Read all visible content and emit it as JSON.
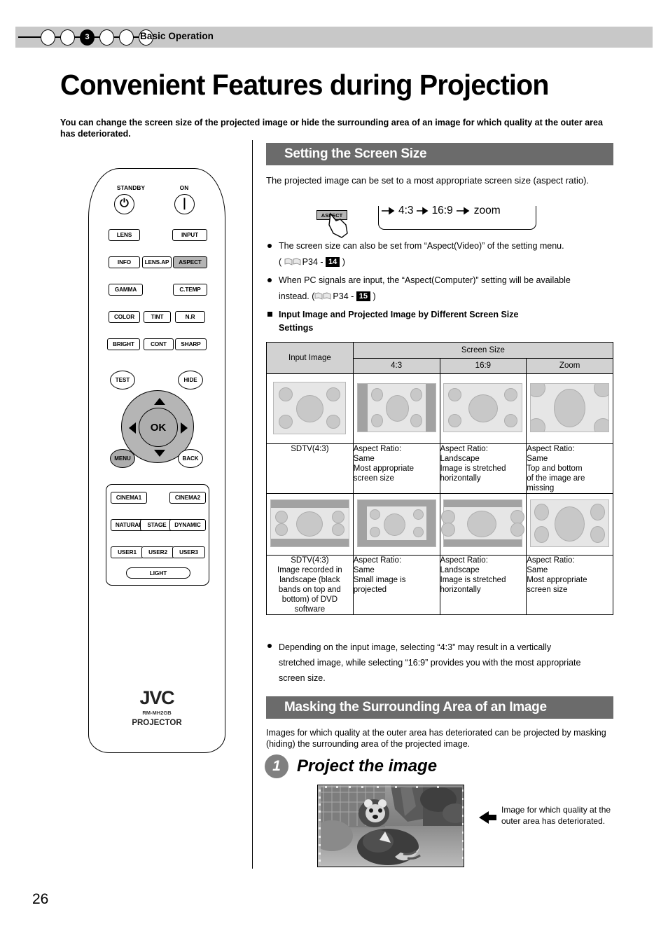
{
  "header": {
    "chapter_label": "Basic Operation",
    "chapter_number": "3",
    "dot_count": 6,
    "active_dot_index": 2
  },
  "page_title": "Convenient Features during Projection",
  "lead_text": "You can change the screen size of the projected image or hide the surrounding area of an image for which quality at the outer area has deteriorated.",
  "page_number": "26",
  "remote": {
    "standby_label": "STANDBY",
    "on_label": "ON",
    "standby_glyph": "⏻",
    "on_glyph": "❘",
    "buttons": {
      "lens": "LENS",
      "input": "INPUT",
      "info": "INFO",
      "lens_ap": "LENS.AP",
      "aspect": "ASPECT",
      "gamma": "GAMMA",
      "ctemp": "C.TEMP",
      "color": "COLOR",
      "tint": "TINT",
      "nr": "N.R",
      "bright": "BRIGHT",
      "cont": "CONT",
      "sharp": "SHARP",
      "test": "TEST",
      "hide": "HIDE",
      "menu": "MENU",
      "back": "BACK",
      "ok": "OK",
      "cinema1": "CINEMA1",
      "cinema2": "CINEMA2",
      "natural": "NATURAL",
      "stage": "STAGE",
      "dynamic": "DYNAMIC",
      "user1": "USER1",
      "user2": "USER2",
      "user3": "USER3",
      "light": "LIGHT"
    },
    "brand": "JVC",
    "model": "RM-MH2GB",
    "type_label": "PROJECTOR",
    "highlight_color": "#b5b5b5"
  },
  "section1": {
    "heading": "Setting the Screen Size",
    "intro": "The projected image can be set to a most appropriate screen size (aspect ratio).",
    "aspect_key_label": "ASPECT",
    "cycle": [
      "4:3",
      "16:9",
      "zoom"
    ],
    "bullets": [
      {
        "text_before": "The screen size can also be set from “Aspect(Video)” of the setting menu.",
        "ref_prefix": "P34 - ",
        "ref_badge": "14"
      },
      {
        "text_before": "When PC signals are input, the “Aspect(Computer)” setting will be available",
        "text_second": "instead. (",
        "ref_prefix": "P34 - ",
        "ref_badge": "15"
      }
    ],
    "subheading_line1": "Input Image and Projected Image by Different Screen Size",
    "subheading_line2": "Settings",
    "note": "Depending on the input image, selecting “4:3” may result in a vertically stretched image, while selecting “16:9” provides you with the most appropriate screen size."
  },
  "table": {
    "col_input": "Input Image",
    "col_group": "Screen Size",
    "cols": [
      "4:3",
      "16:9",
      "Zoom"
    ],
    "rows": [
      {
        "input_label": "SDTV(4:3)",
        "cells": [
          "Aspect Ratio:\nSame\nMost appropriate\nscreen size",
          "Aspect Ratio:\nLandscape\nImage is stretched\nhorizontally",
          "Aspect Ratio:\nSame\nTop and bottom\nof the image are\nmissing"
        ]
      },
      {
        "input_label": "SDTV(4:3)\nImage recorded in\nlandscape (black\nbands on top and\nbottom) of DVD\nsoftware",
        "cells": [
          "Aspect Ratio:\nSame\nSmall image is\nprojected",
          "Aspect Ratio:\nLandscape\nImage is stretched\nhorizontally",
          "Aspect Ratio:\nSame\nMost appropriate\nscreen size"
        ]
      }
    ]
  },
  "section2": {
    "heading": "Masking the Surrounding Area of an Image",
    "intro": "Images for which quality at the outer area has deteriorated can be projected by masking (hiding) the surrounding area of the projected image.",
    "step_number": "1",
    "step_title": "Project the image",
    "photo_caption": "Image for which quality at the outer area has deteriorated."
  },
  "colors": {
    "section_bar": "#6b6b6b",
    "chapter_bar": "#c8c8c8",
    "table_header": "#d2d2d2",
    "screen_light": "#e6e6e6",
    "screen_band": "#a2a2a2",
    "circle_fill": "#c8c8c8"
  }
}
